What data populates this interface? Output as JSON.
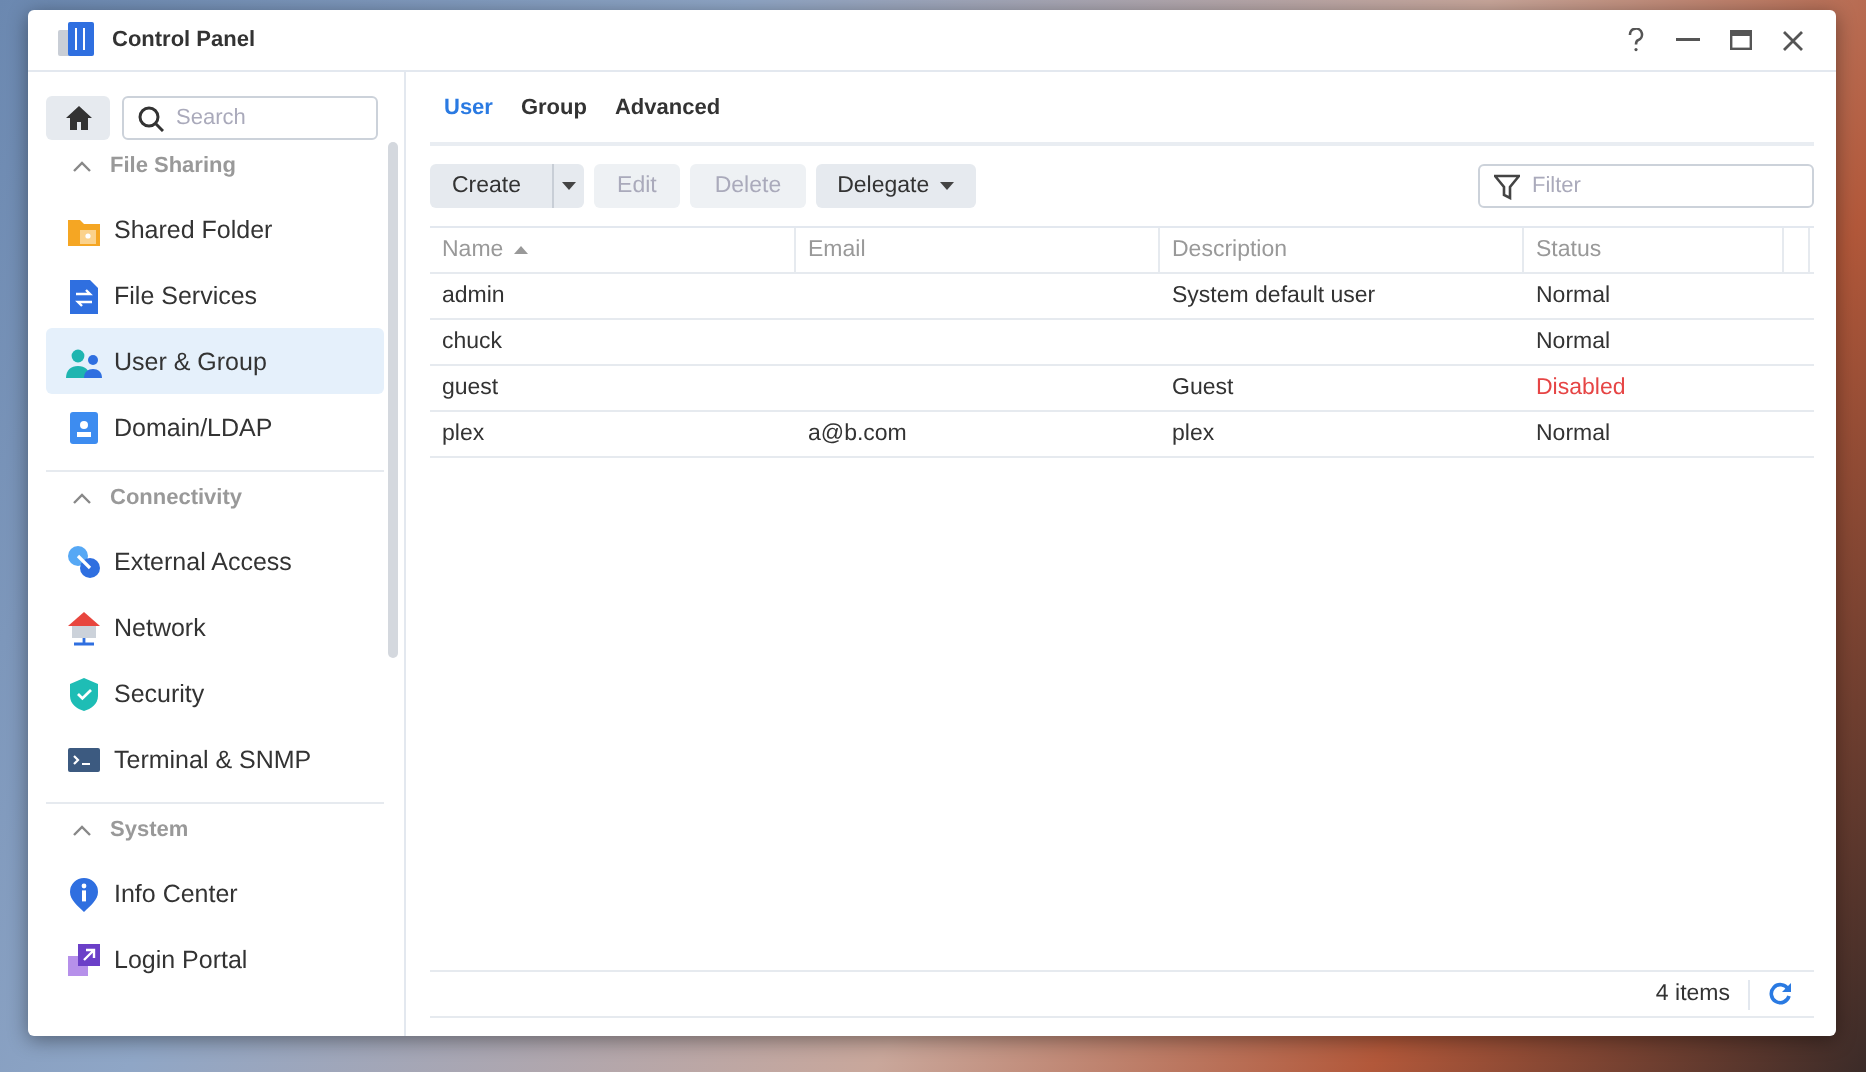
{
  "window": {
    "title": "Control Panel"
  },
  "sidebar": {
    "search": {
      "placeholder": "Search"
    },
    "sections": [
      {
        "title": "File Sharing",
        "expanded": true,
        "items": [
          {
            "label": "Shared Folder",
            "selected": false
          },
          {
            "label": "File Services",
            "selected": false
          },
          {
            "label": "User & Group",
            "selected": true
          },
          {
            "label": "Domain/LDAP",
            "selected": false
          }
        ]
      },
      {
        "title": "Connectivity",
        "expanded": true,
        "items": [
          {
            "label": "External Access",
            "selected": false
          },
          {
            "label": "Network",
            "selected": false
          },
          {
            "label": "Security",
            "selected": false
          },
          {
            "label": "Terminal & SNMP",
            "selected": false
          }
        ]
      },
      {
        "title": "System",
        "expanded": true,
        "items": [
          {
            "label": "Info Center",
            "selected": false
          },
          {
            "label": "Login Portal",
            "selected": false
          }
        ]
      }
    ]
  },
  "tabs": [
    {
      "label": "User",
      "selected": true
    },
    {
      "label": "Group",
      "selected": false
    },
    {
      "label": "Advanced",
      "selected": false
    }
  ],
  "toolbar": {
    "buttons": [
      {
        "label": "Create",
        "kind": "split",
        "disabled": false
      },
      {
        "label": "Edit",
        "kind": "plain",
        "disabled": true
      },
      {
        "label": "Delete",
        "kind": "plain",
        "disabled": true
      },
      {
        "label": "Delegate",
        "kind": "menu",
        "disabled": false
      }
    ],
    "filter": {
      "placeholder": "Filter"
    }
  },
  "table": {
    "columns": [
      {
        "label": "Name",
        "sorted": true
      },
      {
        "label": "Email",
        "sorted": false
      },
      {
        "label": "Description",
        "sorted": false
      },
      {
        "label": "Status",
        "sorted": false
      }
    ],
    "rows": [
      {
        "cells": [
          "admin",
          "",
          "System default user",
          "Normal"
        ],
        "alert": false
      },
      {
        "cells": [
          "chuck",
          "",
          "",
          "Normal"
        ],
        "alert": false
      },
      {
        "cells": [
          "guest",
          "",
          "Guest",
          "Disabled"
        ],
        "alert": true
      },
      {
        "cells": [
          "plex",
          "a@b.com",
          "plex",
          "Normal"
        ],
        "alert": false
      }
    ]
  },
  "status_bar": {
    "count": "4 items"
  }
}
